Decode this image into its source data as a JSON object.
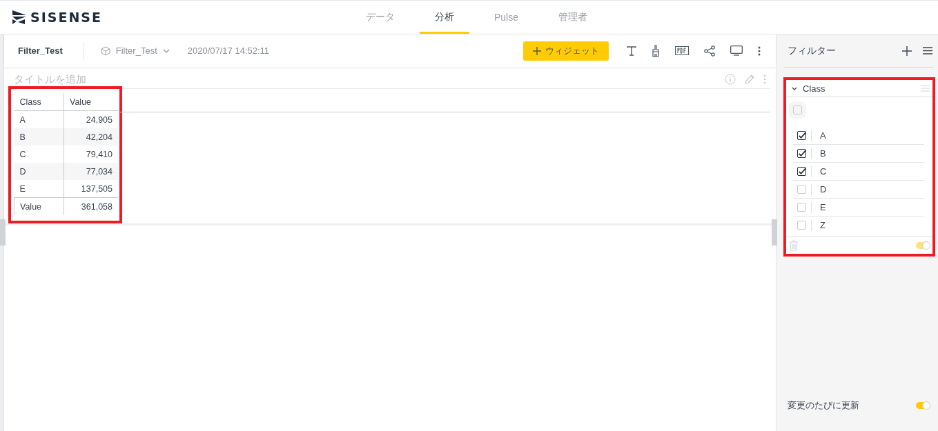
{
  "logo": {
    "text": "SISENSE"
  },
  "nav_tabs": [
    {
      "label": "データ",
      "selected": false
    },
    {
      "label": "分析",
      "selected": true
    },
    {
      "label": "Pulse",
      "selected": false
    },
    {
      "label": "管理者",
      "selected": false
    }
  ],
  "dashboard": {
    "title": "Filter_Test",
    "datasource": "Filter_Test",
    "timestamp": "2020/07/17 14:52:11",
    "add_widget_button": "ウィジェット"
  },
  "widget": {
    "title_placeholder": "タイトルを追加",
    "table": {
      "columns": [
        "Class",
        "Value"
      ],
      "rows": [
        [
          "A",
          "24,905"
        ],
        [
          "B",
          "42,204"
        ],
        [
          "C",
          "79,410"
        ],
        [
          "D",
          "77,034"
        ],
        [
          "E",
          "137,505"
        ]
      ],
      "total": [
        "Value",
        "361,058"
      ]
    }
  },
  "filter_panel": {
    "title": "フィルター",
    "filters": [
      {
        "name": "Class",
        "expanded": true,
        "enabled": true,
        "select_all_checked": false,
        "items": [
          {
            "label": "A",
            "checked": true
          },
          {
            "label": "B",
            "checked": true
          },
          {
            "label": "C",
            "checked": true
          },
          {
            "label": "D",
            "checked": false
          },
          {
            "label": "E",
            "checked": false
          },
          {
            "label": "Z",
            "checked": false
          }
        ]
      }
    ],
    "auto_update": {
      "label": "変更のたびに更新",
      "on": true
    }
  }
}
